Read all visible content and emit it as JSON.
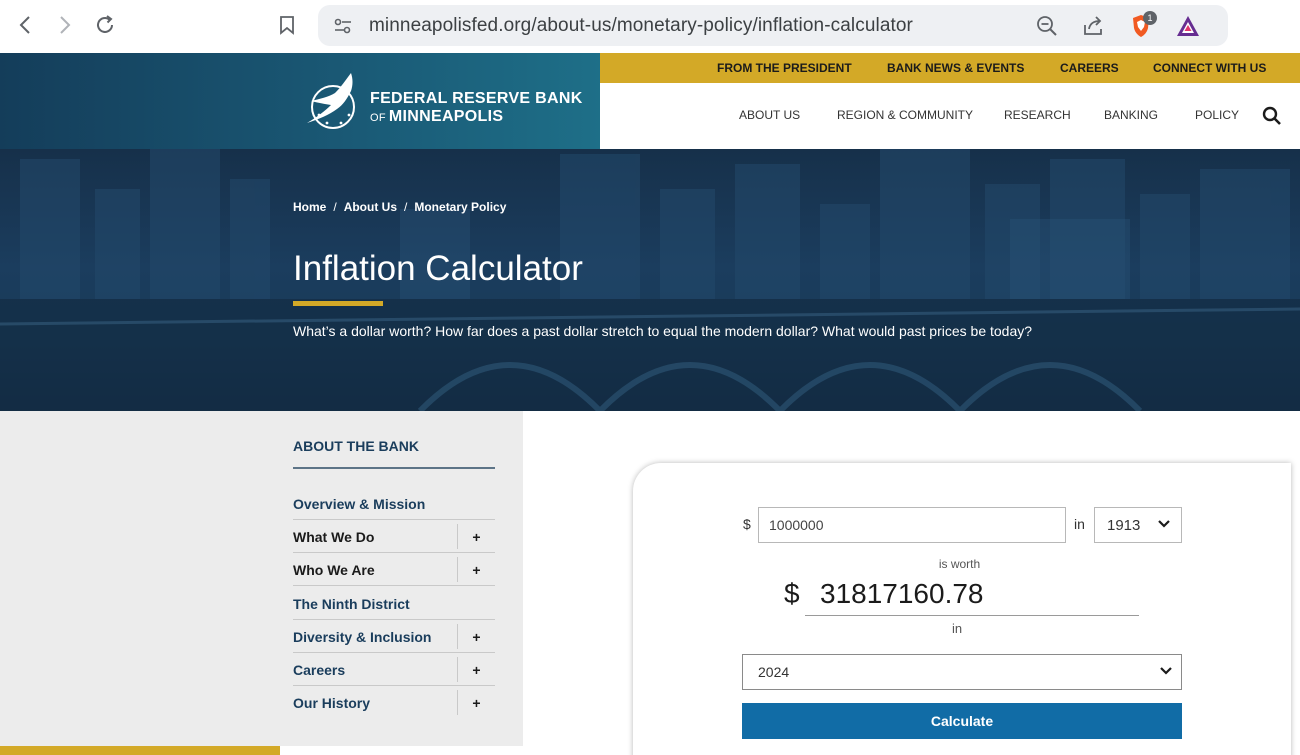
{
  "browser": {
    "url": "minneapolisfed.org/about-us/monetary-policy/inflation-calculator",
    "shields_count": "1"
  },
  "header": {
    "logo_line1": "FEDERAL RESERVE BANK",
    "logo_line2_prefix": "OF",
    "logo_line2_main": "MINNEAPOLIS",
    "top_links": [
      "FROM THE PRESIDENT",
      "BANK NEWS & EVENTS",
      "CAREERS",
      "CONNECT WITH US"
    ],
    "main_links": [
      "ABOUT US",
      "REGION & COMMUNITY",
      "RESEARCH",
      "BANKING",
      "POLICY"
    ]
  },
  "hero": {
    "breadcrumb": [
      "Home",
      "About Us",
      "Monetary Policy"
    ],
    "breadcrumb_sep": "/",
    "title": "Inflation Calculator",
    "subtitle": "What’s a dollar worth? How far does a past dollar stretch to equal the modern dollar? What would past prices be today?"
  },
  "sidebar": {
    "title": "ABOUT THE BANK",
    "items": [
      {
        "label": "Overview & Mission",
        "expand": ""
      },
      {
        "label": "What We Do",
        "expand": "+"
      },
      {
        "label": "Who We Are",
        "expand": "+"
      },
      {
        "label": "The Ninth District",
        "expand": ""
      },
      {
        "label": "Diversity & Inclusion",
        "expand": "+"
      },
      {
        "label": "Careers",
        "expand": "+"
      },
      {
        "label": "Our History",
        "expand": "+"
      }
    ]
  },
  "calculator": {
    "currency_symbol": "$",
    "amount": "1000000",
    "in_label": "in",
    "from_year": "1913",
    "is_worth_label": "is worth",
    "result_symbol": "$",
    "result_value": "31817160.78",
    "to_year": "2024",
    "button_label": "Calculate"
  },
  "colors": {
    "gold": "#d3a927",
    "navy": "#1a3d5c",
    "button_blue": "#116ca6"
  }
}
